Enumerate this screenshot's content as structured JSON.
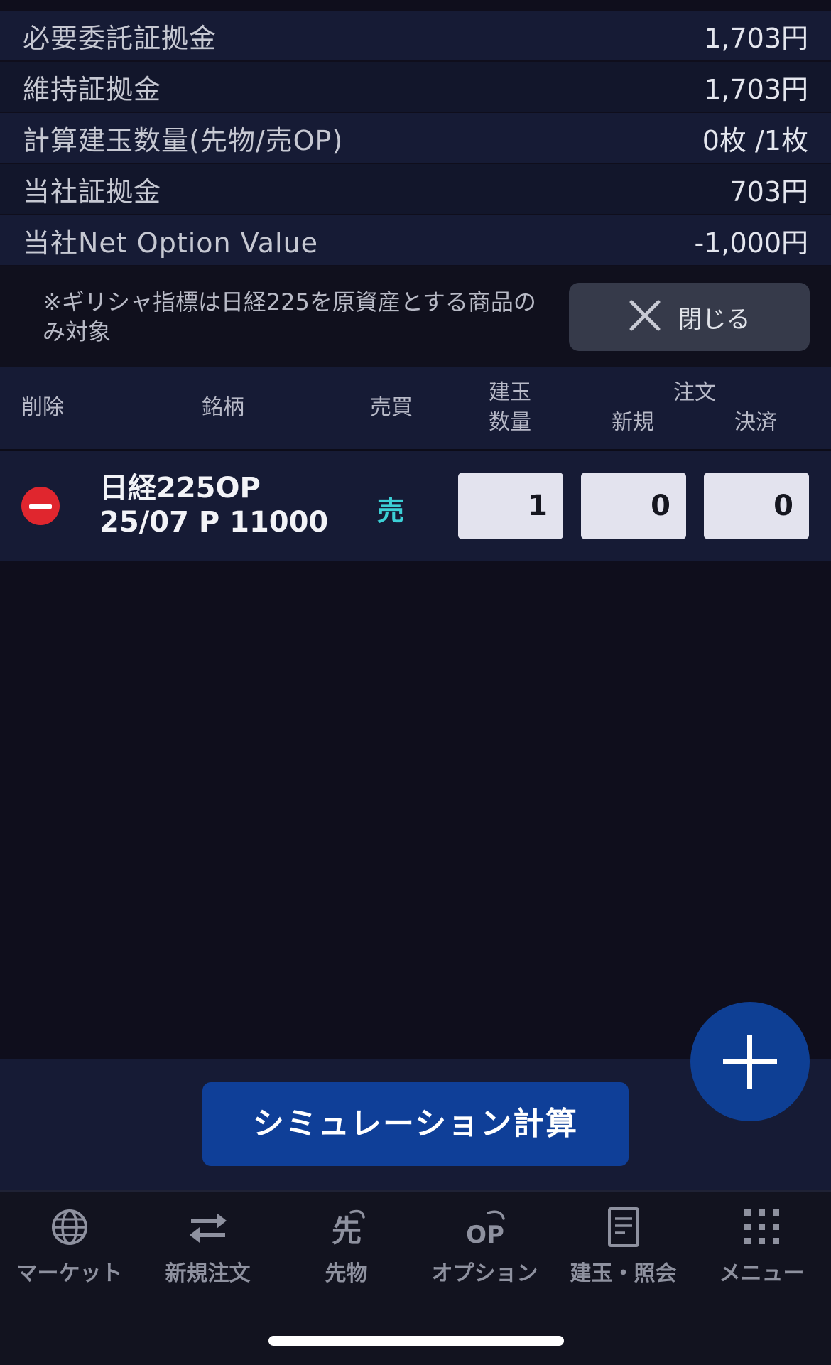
{
  "summary": [
    {
      "label": "必要委託証拠金",
      "value": "1,703円"
    },
    {
      "label": "維持証拠金",
      "value": "1,703円"
    },
    {
      "label": "計算建玉数量(先物/売OP)",
      "value": "0枚 /1枚"
    },
    {
      "label": "当社証拠金",
      "value": "703円"
    },
    {
      "label": "当社Net Option Value",
      "value": "-1,000円"
    }
  ],
  "note": {
    "text": "※ギリシャ指標は日経225を原資産とする商品のみ対象",
    "close_label": "閉じる"
  },
  "table_header": {
    "delete": "削除",
    "instrument": "銘柄",
    "side": "売買",
    "position_line1": "建玉",
    "position_line2": "数量",
    "order": "注文",
    "new": "新規",
    "settle": "決済"
  },
  "rows": [
    {
      "name_line1": "日経225OP",
      "name_line2": "25/07 P 11000",
      "side": "売",
      "position_qty": "1",
      "new_qty": "0",
      "settle_qty": "0"
    }
  ],
  "simulate_label": "シミュレーション計算",
  "tabs": [
    {
      "label": "マーケット",
      "icon": "globe-icon"
    },
    {
      "label": "新規注文",
      "icon": "swap-arrows-icon"
    },
    {
      "label": "先物",
      "icon": "futures-icon",
      "glyph": "先"
    },
    {
      "label": "オプション",
      "icon": "option-icon",
      "glyph": "OP"
    },
    {
      "label": "建玉・照会",
      "icon": "document-icon"
    },
    {
      "label": "メニュー",
      "icon": "grid-menu-icon"
    }
  ],
  "colors": {
    "accent_blue": "#0f3f98",
    "sell": "#3cd0d6",
    "delete_red": "#e0262e"
  }
}
